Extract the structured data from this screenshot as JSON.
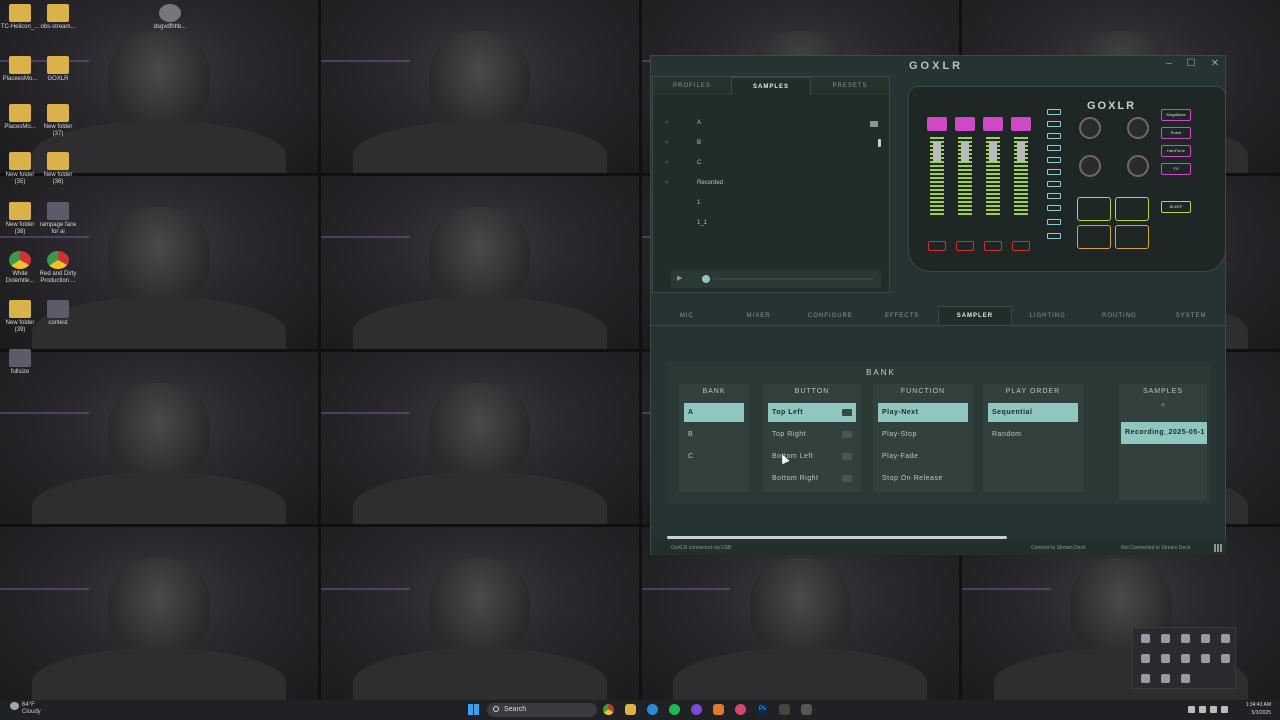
{
  "desktop": {
    "icons": [
      {
        "label": "TC-Helicon_...",
        "kind": "folder"
      },
      {
        "label": "obs-stream...",
        "kind": "folder"
      },
      {
        "label": "dsgvdfhhb...",
        "kind": "ghost"
      },
      {
        "label": "PlaceesMo...",
        "kind": "folder"
      },
      {
        "label": "GOXLR",
        "kind": "folder"
      },
      {
        "label": "PlacesMo...",
        "kind": "folder"
      },
      {
        "label": "New folder (37)",
        "kind": "folder"
      },
      {
        "label": "New folder (35)",
        "kind": "folder"
      },
      {
        "label": "New folder (36)",
        "kind": "folder"
      },
      {
        "label": "New folder (38)",
        "kind": "folder"
      },
      {
        "label": "rampage face for ai",
        "kind": "image"
      },
      {
        "label": "White Dolemite...",
        "kind": "chrome"
      },
      {
        "label": "Red and Dirty Production ...",
        "kind": "chrome"
      },
      {
        "label": "New folder (39)",
        "kind": "folder"
      },
      {
        "label": "contest",
        "kind": "image"
      },
      {
        "label": "fullsize",
        "kind": "image"
      }
    ]
  },
  "app": {
    "logo": "GOXLR",
    "window_controls": {
      "minimize": "–",
      "maximize": "☐",
      "close": "✕"
    },
    "top_tabs": [
      {
        "label": "PROFILES",
        "active": false
      },
      {
        "label": "SAMPLES",
        "active": true
      },
      {
        "label": "PRESETS",
        "active": false
      }
    ],
    "tree": [
      {
        "label": "A",
        "expandable": true
      },
      {
        "label": "B",
        "expandable": true
      },
      {
        "label": "C",
        "expandable": true
      },
      {
        "label": "Recorded",
        "expandable": true
      },
      {
        "label": "1",
        "expandable": false
      },
      {
        "label": "1_1",
        "expandable": false
      }
    ],
    "player": {
      "play_icon": "▶"
    },
    "device": {
      "logo": "GOXLR",
      "fx_labels": [
        "MegaBass",
        "Robot",
        "HardTune",
        "FX",
        "BLEEP"
      ]
    },
    "bottom_tabs": [
      {
        "label": "MIC",
        "active": false
      },
      {
        "label": "MIXER",
        "active": false
      },
      {
        "label": "CONFIGURE",
        "active": false
      },
      {
        "label": "EFFECTS",
        "active": false
      },
      {
        "label": "SAMPLER",
        "active": true
      },
      {
        "label": "LIGHTING",
        "active": false
      },
      {
        "label": "ROUTING",
        "active": false
      },
      {
        "label": "SYSTEM",
        "active": false
      }
    ],
    "sampler": {
      "heading": "BANK",
      "bank": {
        "header": "BANK",
        "items": [
          "A",
          "B",
          "C"
        ],
        "selected": 0
      },
      "button": {
        "header": "BUTTON",
        "items": [
          "Top Left",
          "Top Right",
          "Bottom Left",
          "Bottom Right"
        ],
        "selected": 0
      },
      "function": {
        "header": "FUNCTION",
        "items": [
          "Play-Next",
          "Play-Stop",
          "Play-Fade",
          "Stop On Release"
        ],
        "selected": 0
      },
      "play_order": {
        "header": "PLAY ORDER",
        "items": [
          "Sequential",
          "Random"
        ],
        "selected": 0
      },
      "samples": {
        "header": "SAMPLES",
        "add": "+",
        "items": [
          "Recording_2025-05-1"
        ]
      }
    },
    "status": {
      "left": "GoXLR connected via USB",
      "stream_deck": "Connect to Stream Deck",
      "not_connected": "Not Connected to Stream Deck"
    }
  },
  "taskbar": {
    "weather_temp": "64°F",
    "weather_desc": "Cloudy",
    "search_placeholder": "Search",
    "time": "1:34:43 AM",
    "date": "5/3/2025"
  }
}
